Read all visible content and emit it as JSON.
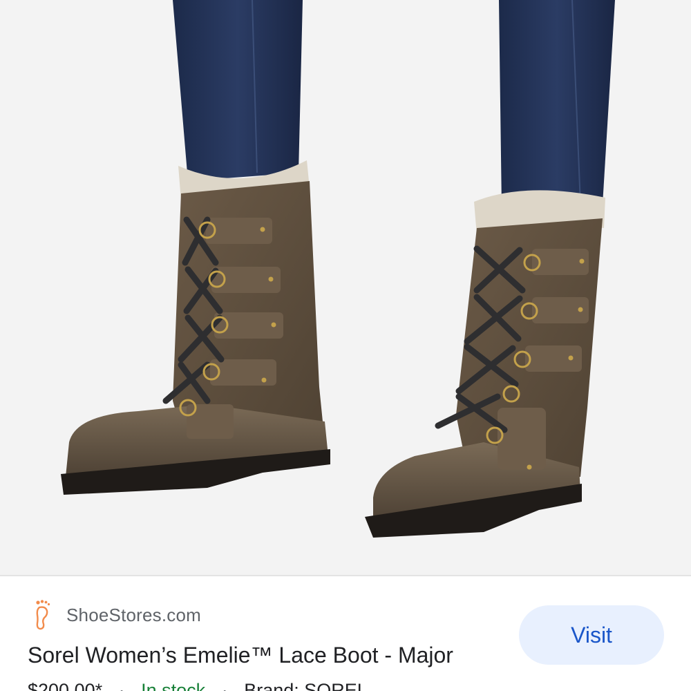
{
  "product_image": {
    "subject": "boots-photo"
  },
  "result": {
    "source_icon": "footprint-icon",
    "source_name": "ShoeStores.com",
    "title": "Sorel Women’s Emelie™ Lace Boot - Major",
    "price": "$200.00*",
    "separator": "·",
    "stock": "In stock",
    "brand": "Brand: SOREL",
    "visit_label": "Visit"
  },
  "colors": {
    "accent": "#1a56c9",
    "button_bg": "#e8f0fe",
    "stock_green": "#188038",
    "icon_orange": "#f28b4b"
  }
}
